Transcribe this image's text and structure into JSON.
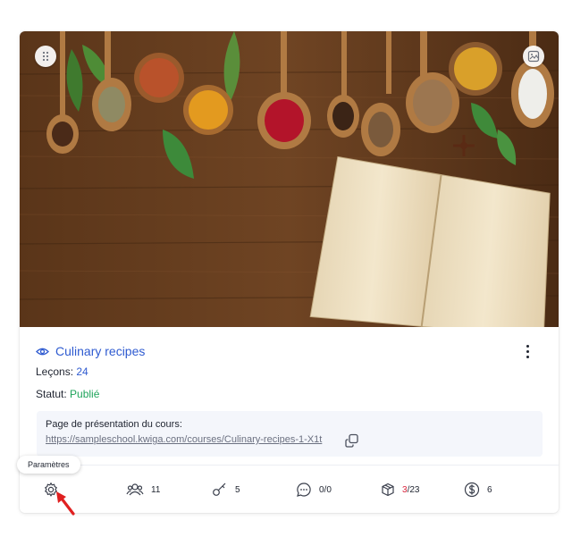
{
  "course": {
    "title": "Culinary recipes",
    "lessons_label": "Leçons:",
    "lessons_value": "24",
    "status_label": "Statut:",
    "status_value": "Publié",
    "presentation_label": "Page de présentation du cours:",
    "presentation_url": "https://sampleschool.kwiga.com/courses/Culinary-recipes-1-X1t"
  },
  "stats": {
    "students": "11",
    "keys": "5",
    "comments": "0/0",
    "modules_done": "3",
    "modules_total": "/23",
    "sales": "6"
  },
  "tooltip": {
    "settings": "Paramètres"
  },
  "colors": {
    "accent": "#2f5bd0",
    "published": "#1fa45b",
    "alert": "#d9233b",
    "arrow": "#e02020"
  },
  "icons": [
    "drag-handle-icon",
    "image-icon",
    "eye-icon",
    "more-vertical-icon",
    "copy-icon",
    "gear-icon",
    "users-icon",
    "key-icon",
    "comment-icon",
    "cube-icon",
    "dollar-icon",
    "arrow-pointer-icon"
  ]
}
